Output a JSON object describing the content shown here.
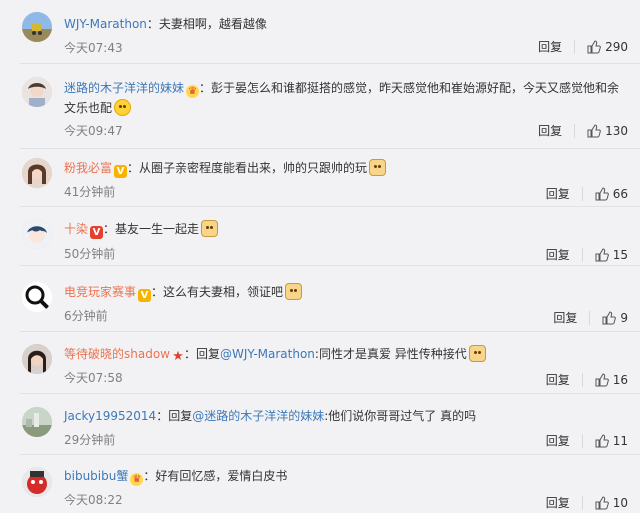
{
  "comments": [
    {
      "user": "WJY-Marathon",
      "badge": "",
      "text": "：夫妻相啊，越看越像",
      "mention": "",
      "tail": "",
      "emoji": "",
      "time": "今天07:43",
      "likes": "290"
    },
    {
      "user": "迷路的木子洋洋的妹妹",
      "badge": "crown",
      "text": "：彭于晏怎么和谁都挺搭的感觉，昨天感觉他和崔始源好配，今天又感觉他和余文乐也配",
      "mention": "",
      "tail": "",
      "emoji": "laugh",
      "time": "今天09:47",
      "likes": "130"
    },
    {
      "user": "粉我必富",
      "badge": "v",
      "text": "：从圈子亲密程度能看出来，帅的只跟帅的玩",
      "mention": "",
      "tail": "",
      "emoji": "dog",
      "time": "41分钟前",
      "likes": "66"
    },
    {
      "user": "十染",
      "badge": "vred",
      "text": "：基友一生一起走",
      "mention": "",
      "tail": "",
      "emoji": "dog",
      "time": "50分钟前",
      "likes": "15"
    },
    {
      "user": "电竞玩家赛事",
      "badge": "v",
      "text": "：这么有夫妻相，领证吧",
      "mention": "",
      "tail": "",
      "emoji": "dog",
      "time": "6分钟前",
      "likes": "9"
    },
    {
      "user": "等待破晓的shadow",
      "badge": "star",
      "text": "：回复",
      "mention": "@WJY-Marathon",
      "tail": ":同性才是真爱 异性传种接代",
      "emoji": "dog",
      "time": "今天07:58",
      "likes": "16"
    },
    {
      "user": "Jacky19952014",
      "badge": "",
      "text": "：回复",
      "mention": "@迷路的木子洋洋的妹妹",
      "tail": ":他们说你哥哥过气了 真的吗",
      "emoji": "",
      "time": "29分钟前",
      "likes": "11"
    },
    {
      "user": "bibubibu蟹",
      "badge": "crown",
      "text": "：好有回忆感，爱情白皮书",
      "mention": "",
      "tail": "",
      "emoji": "",
      "time": "今天08:22",
      "likes": "10"
    }
  ],
  "labels": {
    "reply": "回复"
  },
  "icons": {
    "like": "thumbs-up-icon"
  },
  "colors": {
    "username": "#eb7350",
    "link": "#3d78b8",
    "muted": "#808080",
    "background": "#f2f2f5"
  }
}
